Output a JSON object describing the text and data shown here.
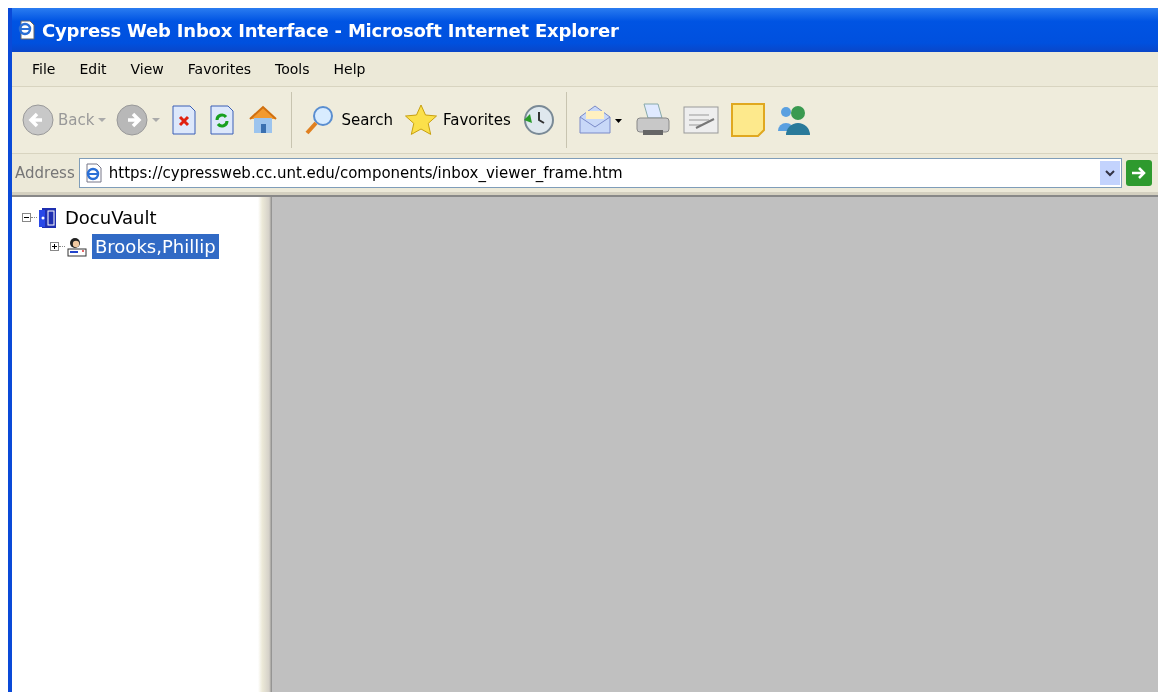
{
  "window": {
    "title": "Cypress Web Inbox Interface - Microsoft Internet Explorer"
  },
  "menu": [
    "File",
    "Edit",
    "View",
    "Favorites",
    "Tools",
    "Help"
  ],
  "toolbar": [
    {
      "kind": "back",
      "label": "Back",
      "disabled": true
    },
    {
      "kind": "forward",
      "disabled": false
    },
    {
      "kind": "stop"
    },
    {
      "kind": "refresh"
    },
    {
      "kind": "home"
    },
    {
      "kind": "separator"
    },
    {
      "kind": "search",
      "label": "Search"
    },
    {
      "kind": "favorites",
      "label": "Favorites"
    },
    {
      "kind": "history"
    },
    {
      "kind": "separator"
    },
    {
      "kind": "mail"
    },
    {
      "kind": "print"
    },
    {
      "kind": "edit"
    },
    {
      "kind": "note"
    },
    {
      "kind": "messenger"
    }
  ],
  "address": {
    "label": "Address",
    "value": "https://cypressweb.cc.unt.edu/components/inbox_viewer_frame.htm"
  },
  "tree": [
    {
      "label": "DocuVault",
      "kind": "vault",
      "expanded": true,
      "selected": false,
      "children": [
        {
          "label": "Brooks,Phillip",
          "kind": "person",
          "expanded": false,
          "selected": true
        }
      ]
    }
  ]
}
